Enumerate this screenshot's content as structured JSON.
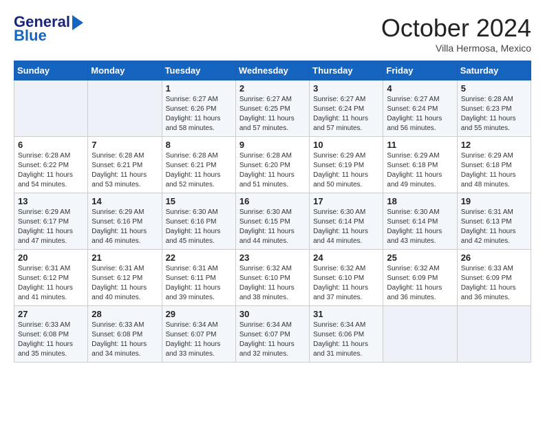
{
  "header": {
    "logo_line1": "General",
    "logo_line2": "Blue",
    "month": "October 2024",
    "location": "Villa Hermosa, Mexico"
  },
  "weekdays": [
    "Sunday",
    "Monday",
    "Tuesday",
    "Wednesday",
    "Thursday",
    "Friday",
    "Saturday"
  ],
  "weeks": [
    [
      {
        "num": "",
        "sunrise": "",
        "sunset": "",
        "daylight": "",
        "empty": true
      },
      {
        "num": "",
        "sunrise": "",
        "sunset": "",
        "daylight": "",
        "empty": true
      },
      {
        "num": "1",
        "sunrise": "Sunrise: 6:27 AM",
        "sunset": "Sunset: 6:26 PM",
        "daylight": "Daylight: 11 hours and 58 minutes."
      },
      {
        "num": "2",
        "sunrise": "Sunrise: 6:27 AM",
        "sunset": "Sunset: 6:25 PM",
        "daylight": "Daylight: 11 hours and 57 minutes."
      },
      {
        "num": "3",
        "sunrise": "Sunrise: 6:27 AM",
        "sunset": "Sunset: 6:24 PM",
        "daylight": "Daylight: 11 hours and 57 minutes."
      },
      {
        "num": "4",
        "sunrise": "Sunrise: 6:27 AM",
        "sunset": "Sunset: 6:24 PM",
        "daylight": "Daylight: 11 hours and 56 minutes."
      },
      {
        "num": "5",
        "sunrise": "Sunrise: 6:28 AM",
        "sunset": "Sunset: 6:23 PM",
        "daylight": "Daylight: 11 hours and 55 minutes."
      }
    ],
    [
      {
        "num": "6",
        "sunrise": "Sunrise: 6:28 AM",
        "sunset": "Sunset: 6:22 PM",
        "daylight": "Daylight: 11 hours and 54 minutes."
      },
      {
        "num": "7",
        "sunrise": "Sunrise: 6:28 AM",
        "sunset": "Sunset: 6:21 PM",
        "daylight": "Daylight: 11 hours and 53 minutes."
      },
      {
        "num": "8",
        "sunrise": "Sunrise: 6:28 AM",
        "sunset": "Sunset: 6:21 PM",
        "daylight": "Daylight: 11 hours and 52 minutes."
      },
      {
        "num": "9",
        "sunrise": "Sunrise: 6:28 AM",
        "sunset": "Sunset: 6:20 PM",
        "daylight": "Daylight: 11 hours and 51 minutes."
      },
      {
        "num": "10",
        "sunrise": "Sunrise: 6:29 AM",
        "sunset": "Sunset: 6:19 PM",
        "daylight": "Daylight: 11 hours and 50 minutes."
      },
      {
        "num": "11",
        "sunrise": "Sunrise: 6:29 AM",
        "sunset": "Sunset: 6:18 PM",
        "daylight": "Daylight: 11 hours and 49 minutes."
      },
      {
        "num": "12",
        "sunrise": "Sunrise: 6:29 AM",
        "sunset": "Sunset: 6:18 PM",
        "daylight": "Daylight: 11 hours and 48 minutes."
      }
    ],
    [
      {
        "num": "13",
        "sunrise": "Sunrise: 6:29 AM",
        "sunset": "Sunset: 6:17 PM",
        "daylight": "Daylight: 11 hours and 47 minutes."
      },
      {
        "num": "14",
        "sunrise": "Sunrise: 6:29 AM",
        "sunset": "Sunset: 6:16 PM",
        "daylight": "Daylight: 11 hours and 46 minutes."
      },
      {
        "num": "15",
        "sunrise": "Sunrise: 6:30 AM",
        "sunset": "Sunset: 6:16 PM",
        "daylight": "Daylight: 11 hours and 45 minutes."
      },
      {
        "num": "16",
        "sunrise": "Sunrise: 6:30 AM",
        "sunset": "Sunset: 6:15 PM",
        "daylight": "Daylight: 11 hours and 44 minutes."
      },
      {
        "num": "17",
        "sunrise": "Sunrise: 6:30 AM",
        "sunset": "Sunset: 6:14 PM",
        "daylight": "Daylight: 11 hours and 44 minutes."
      },
      {
        "num": "18",
        "sunrise": "Sunrise: 6:30 AM",
        "sunset": "Sunset: 6:14 PM",
        "daylight": "Daylight: 11 hours and 43 minutes."
      },
      {
        "num": "19",
        "sunrise": "Sunrise: 6:31 AM",
        "sunset": "Sunset: 6:13 PM",
        "daylight": "Daylight: 11 hours and 42 minutes."
      }
    ],
    [
      {
        "num": "20",
        "sunrise": "Sunrise: 6:31 AM",
        "sunset": "Sunset: 6:12 PM",
        "daylight": "Daylight: 11 hours and 41 minutes."
      },
      {
        "num": "21",
        "sunrise": "Sunrise: 6:31 AM",
        "sunset": "Sunset: 6:12 PM",
        "daylight": "Daylight: 11 hours and 40 minutes."
      },
      {
        "num": "22",
        "sunrise": "Sunrise: 6:31 AM",
        "sunset": "Sunset: 6:11 PM",
        "daylight": "Daylight: 11 hours and 39 minutes."
      },
      {
        "num": "23",
        "sunrise": "Sunrise: 6:32 AM",
        "sunset": "Sunset: 6:10 PM",
        "daylight": "Daylight: 11 hours and 38 minutes."
      },
      {
        "num": "24",
        "sunrise": "Sunrise: 6:32 AM",
        "sunset": "Sunset: 6:10 PM",
        "daylight": "Daylight: 11 hours and 37 minutes."
      },
      {
        "num": "25",
        "sunrise": "Sunrise: 6:32 AM",
        "sunset": "Sunset: 6:09 PM",
        "daylight": "Daylight: 11 hours and 36 minutes."
      },
      {
        "num": "26",
        "sunrise": "Sunrise: 6:33 AM",
        "sunset": "Sunset: 6:09 PM",
        "daylight": "Daylight: 11 hours and 36 minutes."
      }
    ],
    [
      {
        "num": "27",
        "sunrise": "Sunrise: 6:33 AM",
        "sunset": "Sunset: 6:08 PM",
        "daylight": "Daylight: 11 hours and 35 minutes."
      },
      {
        "num": "28",
        "sunrise": "Sunrise: 6:33 AM",
        "sunset": "Sunset: 6:08 PM",
        "daylight": "Daylight: 11 hours and 34 minutes."
      },
      {
        "num": "29",
        "sunrise": "Sunrise: 6:34 AM",
        "sunset": "Sunset: 6:07 PM",
        "daylight": "Daylight: 11 hours and 33 minutes."
      },
      {
        "num": "30",
        "sunrise": "Sunrise: 6:34 AM",
        "sunset": "Sunset: 6:07 PM",
        "daylight": "Daylight: 11 hours and 32 minutes."
      },
      {
        "num": "31",
        "sunrise": "Sunrise: 6:34 AM",
        "sunset": "Sunset: 6:06 PM",
        "daylight": "Daylight: 11 hours and 31 minutes."
      },
      {
        "num": "",
        "sunrise": "",
        "sunset": "",
        "daylight": "",
        "empty": true
      },
      {
        "num": "",
        "sunrise": "",
        "sunset": "",
        "daylight": "",
        "empty": true
      }
    ]
  ]
}
